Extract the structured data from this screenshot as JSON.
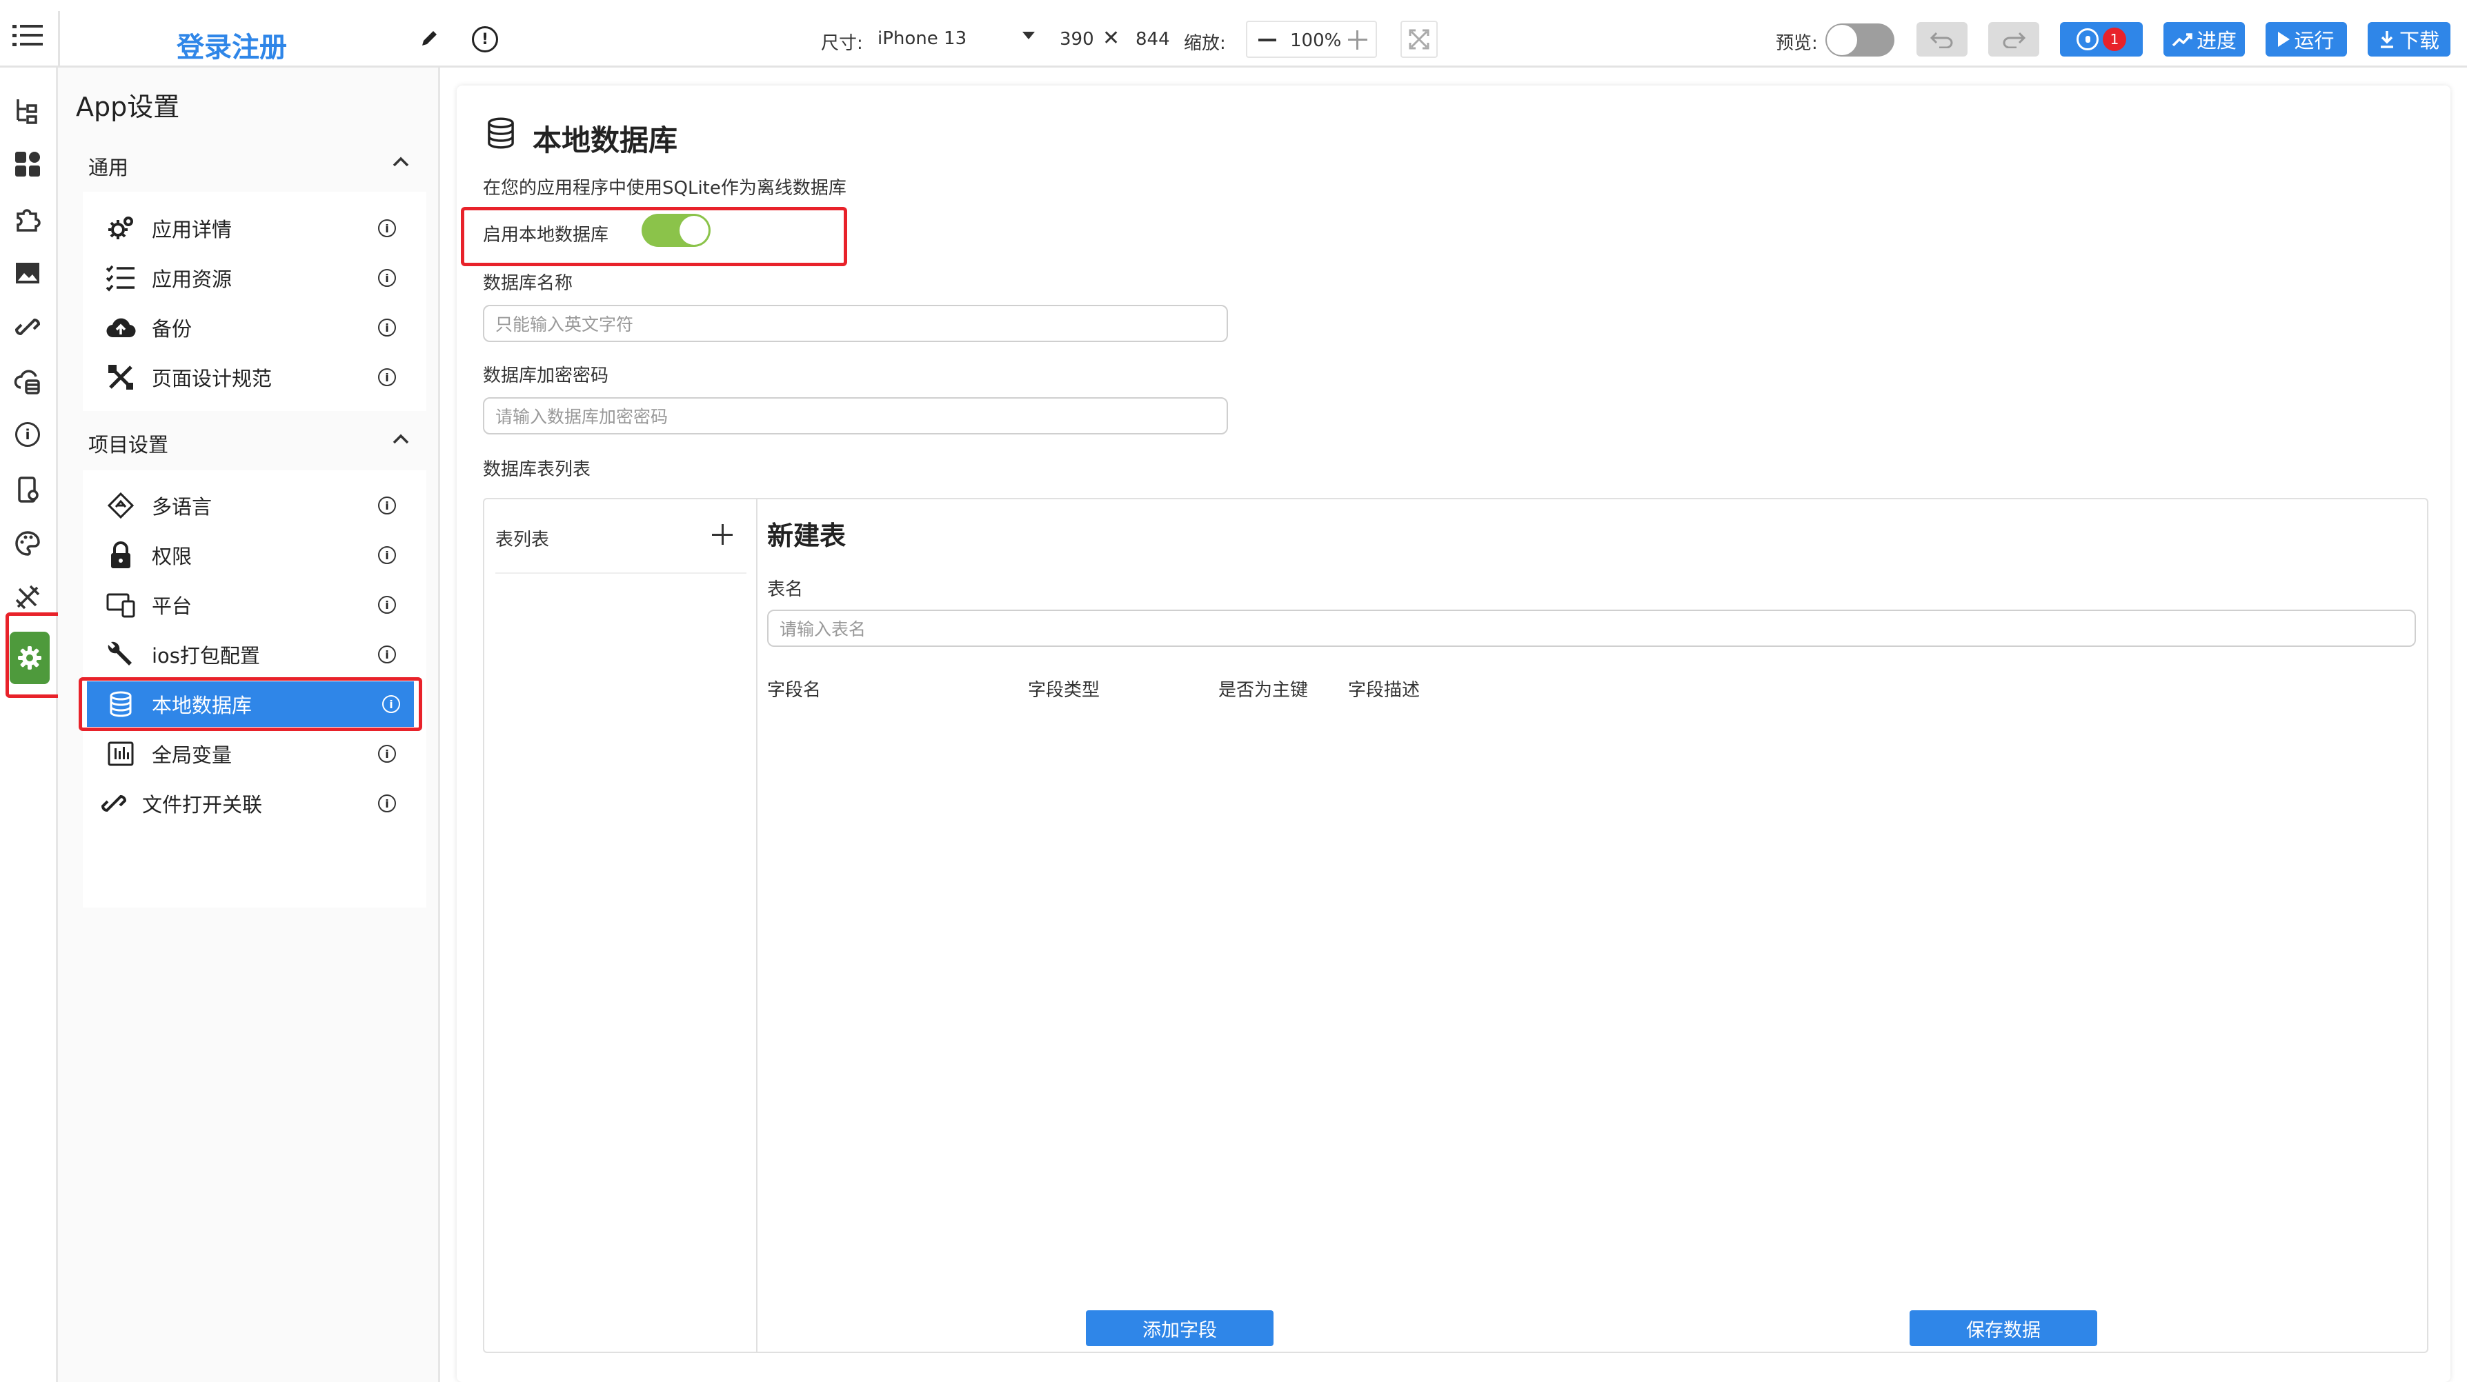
{
  "header": {
    "project_title": "登录注册",
    "size_label": "尺寸:",
    "device": "iPhone 13",
    "width": "390",
    "height": "844",
    "times_symbol": "✕",
    "zoom_label": "缩放:",
    "zoom_value": "100%",
    "preview_label": "预览:",
    "bug_count": "1",
    "progress_label": "进度",
    "run_label": "运行",
    "download_label": "下载"
  },
  "sidebar": {
    "title": "App设置",
    "general": {
      "label": "通用",
      "items": [
        "应用详情",
        "应用资源",
        "备份",
        "页面设计规范"
      ]
    },
    "project": {
      "label": "项目设置",
      "items": [
        "多语言",
        "权限",
        "平台",
        "ios打包配置",
        "本地数据库",
        "全局变量",
        "文件打开关联"
      ]
    }
  },
  "main": {
    "title": "本地数据库",
    "description": "在您的应用程序中使用SQLite作为离线数据库",
    "enable_label": "启用本地数据库",
    "enabled": true,
    "db_name_label": "数据库名称",
    "db_name_placeholder": "只能输入英文字符",
    "db_password_label": "数据库加密密码",
    "db_password_placeholder": "请输入数据库加密密码",
    "table_list_section": "数据库表列表",
    "table_list_label": "表列表",
    "new_table_title": "新建表",
    "table_name_label": "表名",
    "table_name_placeholder": "请输入表名",
    "columns": [
      "字段名",
      "字段类型",
      "是否为主键",
      "字段描述"
    ],
    "add_field_button": "添加字段",
    "save_button": "保存数据"
  },
  "colors": {
    "accent": "#2f86e8",
    "active_green": "#4e9a3c",
    "toggle_green": "#8bc34a",
    "highlight_red": "#e8222a"
  }
}
